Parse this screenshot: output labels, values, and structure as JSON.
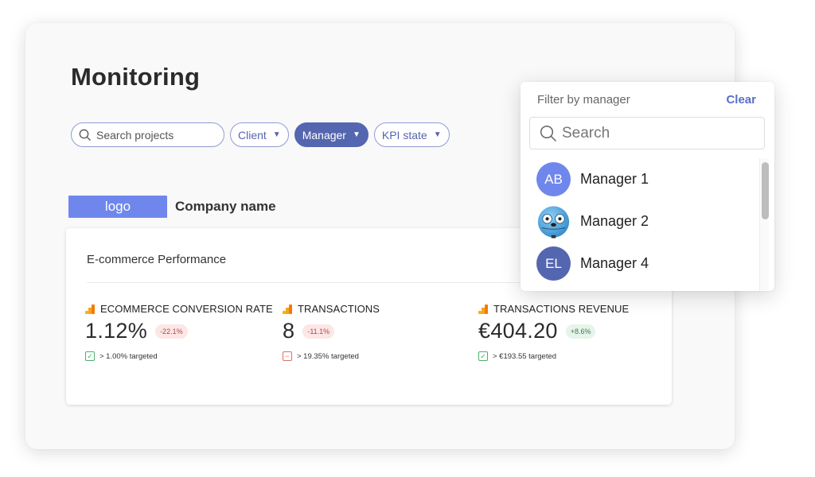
{
  "page": {
    "title": "Monitoring"
  },
  "filters": {
    "search_placeholder": "Search projects",
    "chips": [
      {
        "label": "Client",
        "active": false
      },
      {
        "label": "Manager",
        "active": true
      },
      {
        "label": "KPI state",
        "active": false
      }
    ]
  },
  "company": {
    "logo_label": "logo",
    "name": "Company name"
  },
  "card": {
    "title": "E-commerce Performance",
    "kpis": [
      {
        "label": "ECOMMERCE CONVERSION RATE",
        "value": "1.12%",
        "delta": "-22.1%",
        "delta_state": "negative",
        "target": "> 1.00% targeted",
        "target_met": true
      },
      {
        "label": "TRANSACTIONS",
        "value": "8",
        "delta": "-11.1%",
        "delta_state": "negative",
        "target": "> 19.35% targeted",
        "target_met": false
      },
      {
        "label": "TRANSACTIONS REVENUE",
        "value": "€404.20",
        "delta": "+8.6%",
        "delta_state": "positive",
        "target": "> €193.55 targeted",
        "target_met": true
      }
    ]
  },
  "dropdown": {
    "title": "Filter by manager",
    "clear_label": "Clear",
    "search_placeholder": "Search",
    "managers": [
      {
        "initials": "AB",
        "name": "Manager 1",
        "avatar_color": "#6f87ec",
        "avatar_type": "initials"
      },
      {
        "initials": "",
        "name": "Manager 2",
        "avatar_color": "#5aaee8",
        "avatar_type": "image"
      },
      {
        "initials": "EL",
        "name": "Manager 4",
        "avatar_color": "#5566b0",
        "avatar_type": "initials"
      }
    ]
  },
  "colors": {
    "accent": "#5566b0",
    "logo": "#6f87ec",
    "negative_bg": "#fde6e6",
    "positive_bg": "#e6f4ea"
  }
}
